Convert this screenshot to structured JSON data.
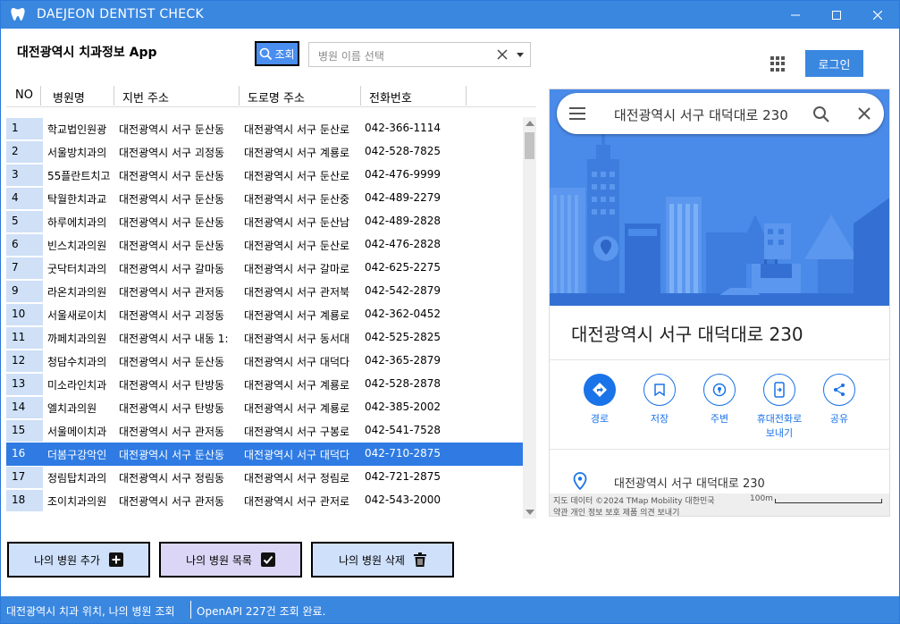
{
  "window": {
    "title": "DAEJEON DENTIST CHECK"
  },
  "header": {
    "app_title": "대전광역시 치과정보 App",
    "search_button_label": "조회",
    "hospital_select_placeholder": "병원 이름 선택",
    "login_label": "로그인"
  },
  "table": {
    "columns": [
      "NO",
      "병원명",
      "지번 주소",
      "도로명 주소",
      "전화번호"
    ],
    "selected_no": "16",
    "rows": [
      {
        "no": "1",
        "name": "학교법인원광",
        "jibun": "대전광역시 서구 둔산동",
        "road": "대전광역시 서구 둔산로",
        "tel": "042-366-1114"
      },
      {
        "no": "2",
        "name": "서울방치과의",
        "jibun": "대전광역시 서구 괴정동",
        "road": "대전광역시 서구 계룡로",
        "tel": "042-528-7825"
      },
      {
        "no": "3",
        "name": "55플란트치고",
        "jibun": "대전광역시 서구 둔산동",
        "road": "대전광역시 서구 둔산로",
        "tel": "042-476-9999"
      },
      {
        "no": "4",
        "name": "탁월한치과교",
        "jibun": "대전광역시 서구 둔산동",
        "road": "대전광역시 서구 둔산중",
        "tel": "042-489-2279"
      },
      {
        "no": "5",
        "name": "하루에치과의",
        "jibun": "대전광역시 서구 둔산동",
        "road": "대전광역시 서구 둔산남",
        "tel": "042-489-2828"
      },
      {
        "no": "6",
        "name": "빈스치과의원",
        "jibun": "대전광역시 서구 둔산동",
        "road": "대전광역시 서구 둔산로",
        "tel": "042-476-2828"
      },
      {
        "no": "7",
        "name": "굿닥터치과의",
        "jibun": "대전광역시 서구 갈마동",
        "road": "대전광역시 서구 갈마로",
        "tel": "042-625-2275"
      },
      {
        "no": "9",
        "name": "라온치과의원",
        "jibun": "대전광역시 서구 관저동",
        "road": "대전광역시 서구 관저북",
        "tel": "042-542-2879"
      },
      {
        "no": "10",
        "name": "서울새로이치",
        "jibun": "대전광역시 서구 괴정동",
        "road": "대전광역시 서구 계룡로",
        "tel": "042-362-0452"
      },
      {
        "no": "11",
        "name": "까페치과의원",
        "jibun": "대전광역시 서구 내동 1:",
        "road": "대전광역시 서구 동서대",
        "tel": "042-525-2825"
      },
      {
        "no": "12",
        "name": "청담수치과의",
        "jibun": "대전광역시 서구 둔산동",
        "road": "대전광역시 서구 대덕다",
        "tel": "042-365-2879"
      },
      {
        "no": "13",
        "name": "미소라인치과",
        "jibun": "대전광역시 서구 탄방동",
        "road": "대전광역시 서구 계룡로",
        "tel": "042-528-2878"
      },
      {
        "no": "14",
        "name": "엘치과의원",
        "jibun": "대전광역시 서구 탄방동",
        "road": "대전광역시 서구 계룡로",
        "tel": "042-385-2002"
      },
      {
        "no": "15",
        "name": "서울메이치과",
        "jibun": "대전광역시 서구 관저동",
        "road": "대전광역시 서구 구봉로",
        "tel": "042-541-7528"
      },
      {
        "no": "16",
        "name": "더봄구강악인",
        "jibun": "대전광역시 서구 둔산동",
        "road": "대전광역시 서구 대덕다",
        "tel": "042-710-2875"
      },
      {
        "no": "17",
        "name": "정림탑치과의",
        "jibun": "대전광역시 서구 정림동",
        "road": "대전광역시 서구 정림로",
        "tel": "042-721-2875"
      },
      {
        "no": "18",
        "name": "조이치과의원",
        "jibun": "대전광역시 서구 관저동",
        "road": "대전광역시 서구 관저로",
        "tel": "042-543-2000"
      }
    ]
  },
  "actions": {
    "add_label": "나의 병원 추가",
    "list_label": "나의 병원 목록",
    "delete_label": "나의 병원 삭제"
  },
  "map": {
    "search_query": "대전광역시 서구 대덕대로 230",
    "place_title": "대전광역시 서구 대덕대로 230",
    "buttons": {
      "directions": "경로",
      "save": "저장",
      "nearby": "주변",
      "send_line1": "휴대전화로",
      "send_line2": "보내기",
      "share": "공유"
    },
    "address": "대전광역시 서구 대덕대로 230",
    "attribution_line1": "지도 데이터 ©2024 TMap Mobility    대한민국",
    "attribution_scale": "100m",
    "attribution_line2": "약관    개인 정보 보호    제품 의견 보내기"
  },
  "status": {
    "left": "대전광역시 치과 위치, 나의 병원 조회",
    "right": "OpenAPI 227건 조회 완료."
  },
  "colors": {
    "accent": "#3a87e0",
    "selected_row": "#2f7be3",
    "map_hero": "#4a8ae8",
    "google_blue": "#1a73e8"
  }
}
